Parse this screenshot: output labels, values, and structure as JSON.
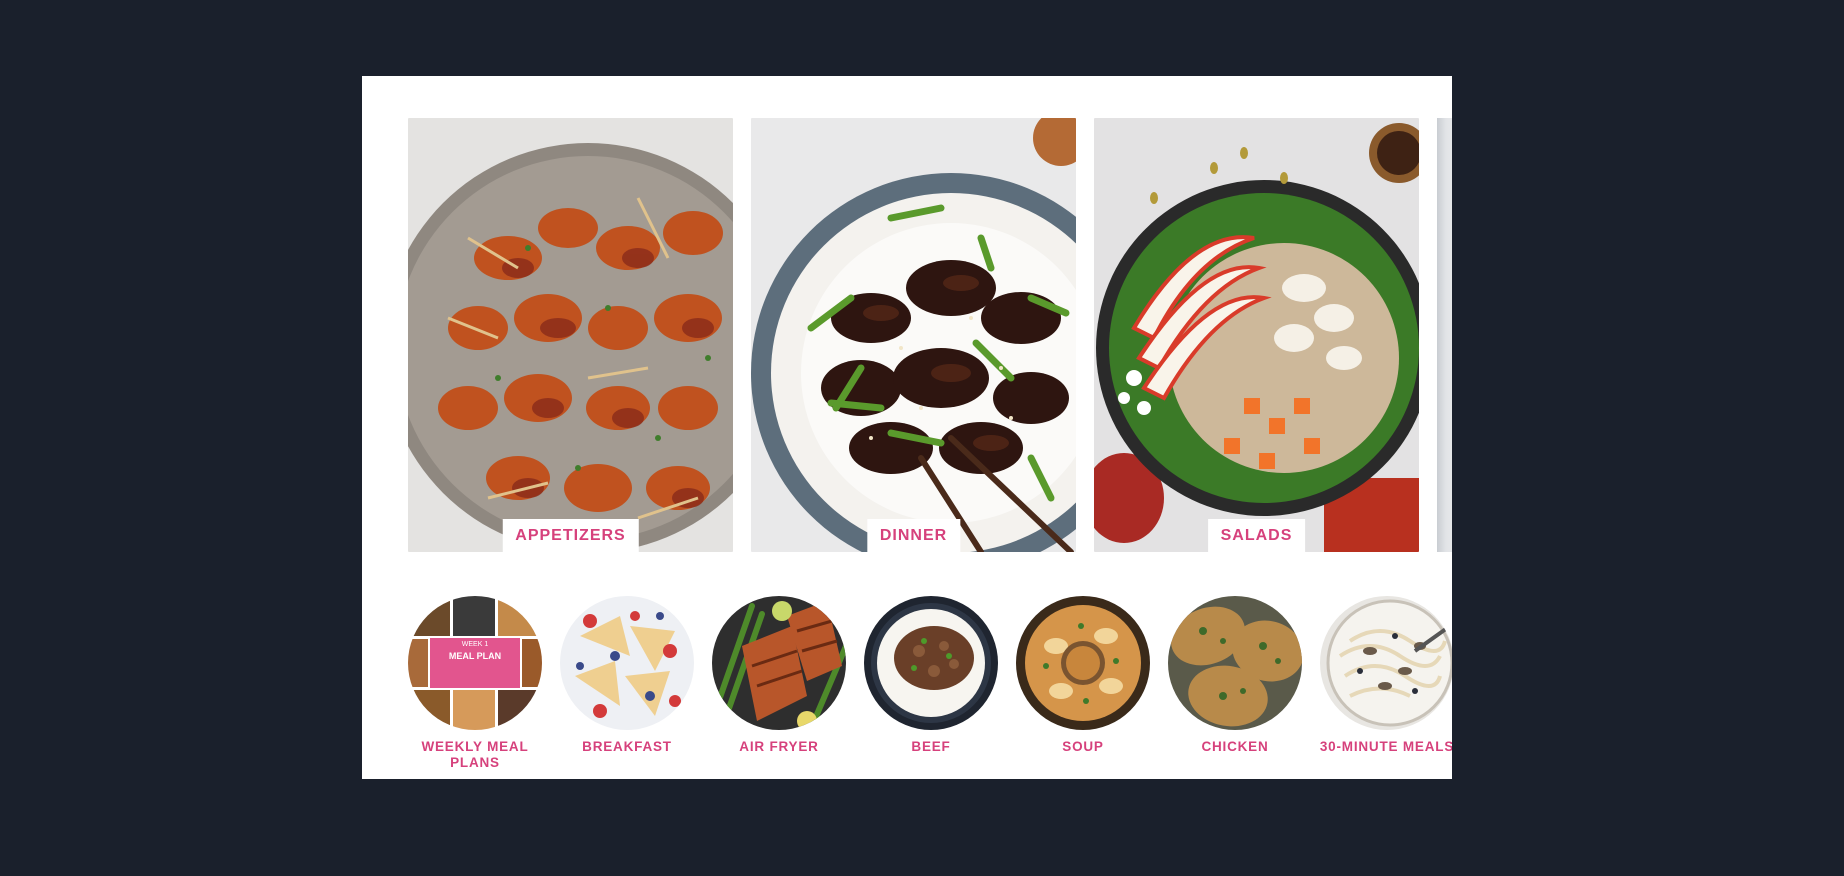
{
  "categories": [
    {
      "label": "APPETIZERS",
      "image": "bacon-wrapped-shrimp-photo"
    },
    {
      "label": "DINNER",
      "image": "mongolian-beef-photo"
    },
    {
      "label": "SALADS",
      "image": "apple-kale-salad-photo"
    }
  ],
  "quick_links": [
    {
      "label": "WEEKLY MEAL PLANS",
      "image": "meal-plan-collage-photo"
    },
    {
      "label": "BREAKFAST",
      "image": "crepes-photo"
    },
    {
      "label": "AIR FRYER",
      "image": "salmon-asparagus-photo"
    },
    {
      "label": "BEEF",
      "image": "ground-beef-rice-photo"
    },
    {
      "label": "SOUP",
      "image": "creamy-soup-photo"
    },
    {
      "label": "CHICKEN",
      "image": "herbed-chicken-photo"
    },
    {
      "label": "30-MINUTE MEALS",
      "image": "mushroom-pasta-photo"
    }
  ],
  "meal_plan_badge": {
    "line1": "WEEK 1",
    "line2": "MEAL PLAN"
  },
  "colors": {
    "accent": "#d6417c",
    "page_bg": "#1a202c",
    "panel_bg": "#ffffff"
  }
}
